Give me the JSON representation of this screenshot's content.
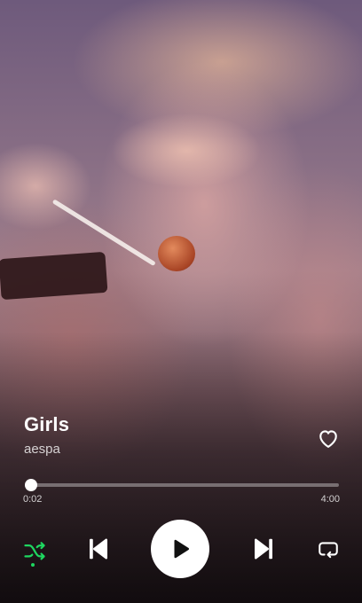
{
  "track": {
    "title": "Girls",
    "artist": "aespa",
    "liked": false
  },
  "playback": {
    "elapsed": "0:02",
    "duration": "4:00",
    "progress_fraction": 0.0083,
    "is_playing": false,
    "shuffle_on": true,
    "repeat_on": false
  },
  "colors": {
    "accent": "#1ed760",
    "text": "#ffffff"
  },
  "icons": {
    "like": "heart-outline-icon",
    "shuffle": "shuffle-icon",
    "previous": "skip-previous-icon",
    "play": "play-icon",
    "next": "skip-next-icon",
    "repeat": "repeat-icon"
  }
}
